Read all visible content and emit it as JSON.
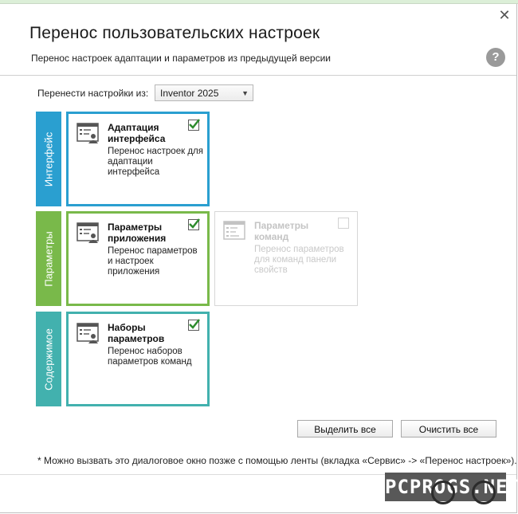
{
  "dialog": {
    "title": "Перенос пользовательских настроек",
    "subtitle": "Перенос настроек адаптации и параметров из предыдущей версии",
    "close_icon": "close-icon",
    "help_label": "?"
  },
  "source": {
    "label": "Перенести настройки из:",
    "selected": "Inventor 2025"
  },
  "bands": {
    "interface": "Интерфейс",
    "parameters": "Параметры",
    "content": "Содержимое"
  },
  "cards": {
    "ui_adapt": {
      "title": "Адаптация интерфейса",
      "desc": "Перенос настроек для адаптации интерфейса",
      "checked": true
    },
    "app_params": {
      "title": "Параметры приложения",
      "desc": "Перенос параметров и настроек приложения",
      "checked": true
    },
    "cmd_params": {
      "title": "Параметры команд",
      "desc": "Перенос параметров для команд панели свойств",
      "checked": false,
      "enabled": false
    },
    "param_sets": {
      "title": "Наборы параметров",
      "desc": "Перенос наборов параметров команд",
      "checked": true
    }
  },
  "buttons": {
    "select_all": "Выделить все",
    "clear_all": "Очистить все"
  },
  "footnote": "* Можно вызвать это диалоговое окно позже с помощью ленты (вкладка «Сервис» -> «Перенос настроек»).",
  "watermark": "PCPROGS.NET",
  "colors": {
    "interface": "#2a9fd0",
    "parameters": "#79b94a",
    "content": "#42b1ae",
    "check": "#2e8b2e"
  }
}
